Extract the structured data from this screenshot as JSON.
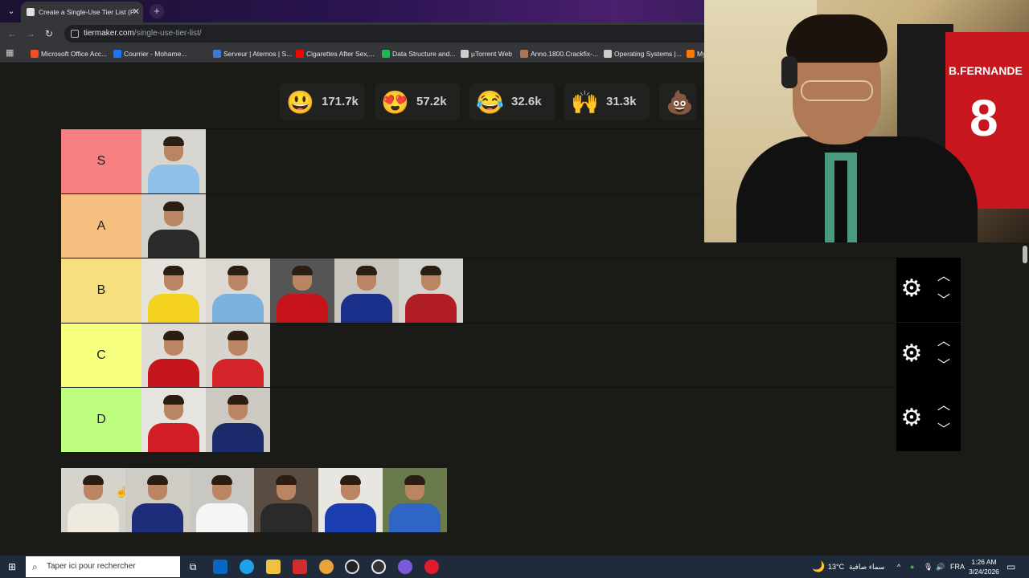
{
  "browser": {
    "tab_title": "Create a Single-Use Tier List (P",
    "url_host": "tiermaker.com",
    "url_path": "/single-use-tier-list/",
    "bookmarks": [
      {
        "label": "Microsoft Office Acc...",
        "color": "#f25022"
      },
      {
        "label": "Courrier - Mohame...",
        "color": "#1877f2"
      },
      {
        "label": "Serveur | Aternos | S...",
        "color": "#3a7bd5"
      },
      {
        "label": "Cigarettes After Sex,...",
        "color": "#ff0000"
      },
      {
        "label": "Data Structure and...",
        "color": "#1db954"
      },
      {
        "label": "µTorrent Web",
        "color": "#cccccc"
      },
      {
        "label": "Anno.1800.Crackfix-...",
        "color": "#aa7755"
      },
      {
        "label": "Operating Systems |...",
        "color": "#cccccc"
      },
      {
        "label": "My",
        "color": "#ff7a00"
      }
    ]
  },
  "reactions": [
    {
      "emoji": "😃",
      "count": "171.7k"
    },
    {
      "emoji": "😍",
      "count": "57.2k"
    },
    {
      "emoji": "😂",
      "count": "32.6k"
    },
    {
      "emoji": "🙌",
      "count": "31.3k"
    },
    {
      "emoji": "💩",
      "count": ""
    }
  ],
  "tiers": [
    {
      "label": "S",
      "color": "#f77f7f",
      "items": [
        {
          "shirt": "#8fc2e8",
          "bg": "#d8d6d0"
        }
      ]
    },
    {
      "label": "A",
      "color": "#f7bf7f",
      "items": [
        {
          "shirt": "#2a2a2a",
          "bg": "#d3d1cb"
        }
      ]
    },
    {
      "label": "B",
      "color": "#f7df7f",
      "items": [
        {
          "shirt": "#f4d21f",
          "bg": "#e5e3dc"
        },
        {
          "shirt": "#7bb2de",
          "bg": "#dcd9d2"
        },
        {
          "shirt": "#c7141a",
          "bg": "#555555"
        },
        {
          "shirt": "#1a2f8a",
          "bg": "#c8c5bf"
        },
        {
          "shirt": "#b01d22",
          "bg": "#d4d2cc"
        }
      ]
    },
    {
      "label": "C",
      "color": "#f7ff7f",
      "items": [
        {
          "shirt": "#c4161c",
          "bg": "#dedcd5"
        },
        {
          "shirt": "#d4242a",
          "bg": "#d6d4cd"
        }
      ]
    },
    {
      "label": "D",
      "color": "#bfff7f",
      "items": [
        {
          "shirt": "#d21f25",
          "bg": "#e6e4de"
        },
        {
          "shirt": "#1c2a6b",
          "bg": "#ccc9c2"
        }
      ]
    }
  ],
  "pool": [
    {
      "shirt": "#efeae0",
      "bg": "#d5d3cc"
    },
    {
      "shirt": "#1d2d7a",
      "bg": "#cfccc6"
    },
    {
      "shirt": "#f5f5f5",
      "bg": "#c9c7c1"
    },
    {
      "shirt": "#2a2a2a",
      "bg": "#5a4c40"
    },
    {
      "shirt": "#1b3fb0",
      "bg": "#e8e6e0"
    },
    {
      "shirt": "#2f66c6",
      "bg": "#6b7a4a"
    }
  ],
  "webcam": {
    "jersey_name": "B.FERNANDE",
    "jersey_number": "8"
  },
  "taskbar": {
    "search_placeholder": "Taper ici pour rechercher",
    "weather_temp": "13°C",
    "weather_desc": "سماء صافية",
    "language": "FRA",
    "time": "1:26 AM",
    "date": "3/24/2026"
  }
}
